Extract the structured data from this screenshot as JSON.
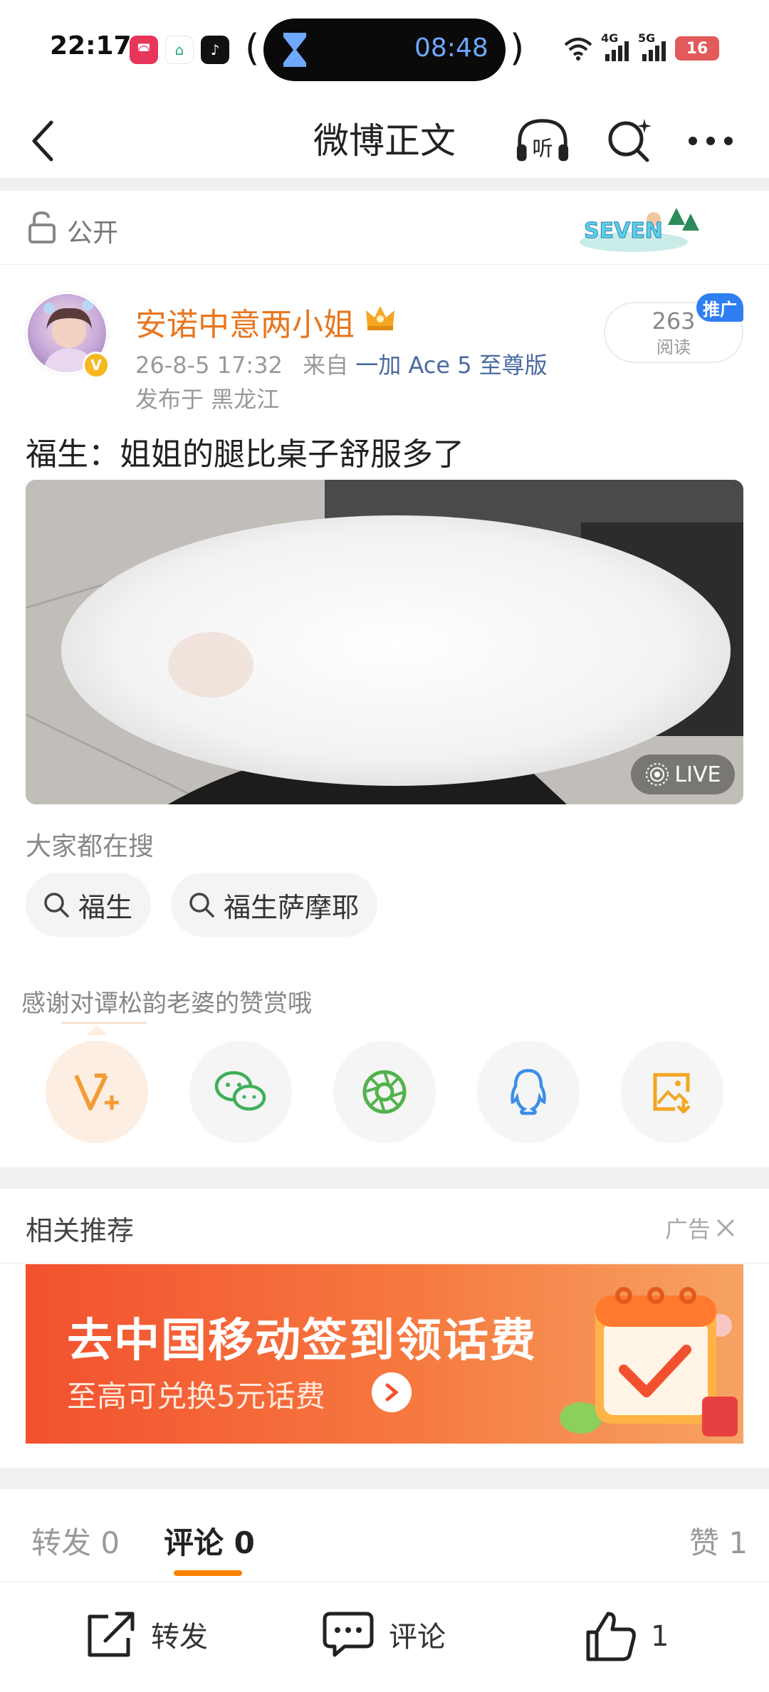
{
  "status_bar": {
    "time": "22:17",
    "timer": "08:48",
    "battery": "16",
    "signal_4g": "4G",
    "signal_5g": "5G"
  },
  "nav": {
    "title": "微博正文",
    "listen_label": "听"
  },
  "visibility": {
    "label": "公开",
    "badge_text": "SEVEN"
  },
  "post": {
    "author": "安诺中意两小姐",
    "date": "26-8-5 17:32",
    "from_prefix": "来自",
    "source": "一加 Ace 5 至尊版",
    "location_prefix": "发布于",
    "location": "黑龙江",
    "read_count": "263",
    "read_label": "阅读",
    "promo_tag": "推广",
    "text": "福生：姐姐的腿比桌子舒服多了",
    "live_label": "LIVE"
  },
  "search": {
    "title": "大家都在搜",
    "chips": [
      "福生",
      "福生萨摩耶"
    ]
  },
  "reward": {
    "thanks_text": "感谢对谭松韵老婆的赞赏哦"
  },
  "share_icons": [
    "reward-v-icon",
    "wechat-icon",
    "moments-icon",
    "qq-icon",
    "save-image-icon"
  ],
  "related": {
    "title": "相关推荐",
    "ad_label": "广告",
    "banner_title": "去中国移动签到领话费",
    "banner_subtitle": "至高可兑换5元话费"
  },
  "tabs": {
    "repost": "转发 0",
    "comment": "评论 0",
    "like": "赞 1"
  },
  "bottom_bar": {
    "repost": "转发",
    "comment": "评论",
    "like_count": "1"
  },
  "colors": {
    "accent_orange": "#ff8200",
    "author_orange": "#e8761f",
    "promo_blue": "#2f7ff2",
    "link_blue": "#4a6aa0"
  }
}
